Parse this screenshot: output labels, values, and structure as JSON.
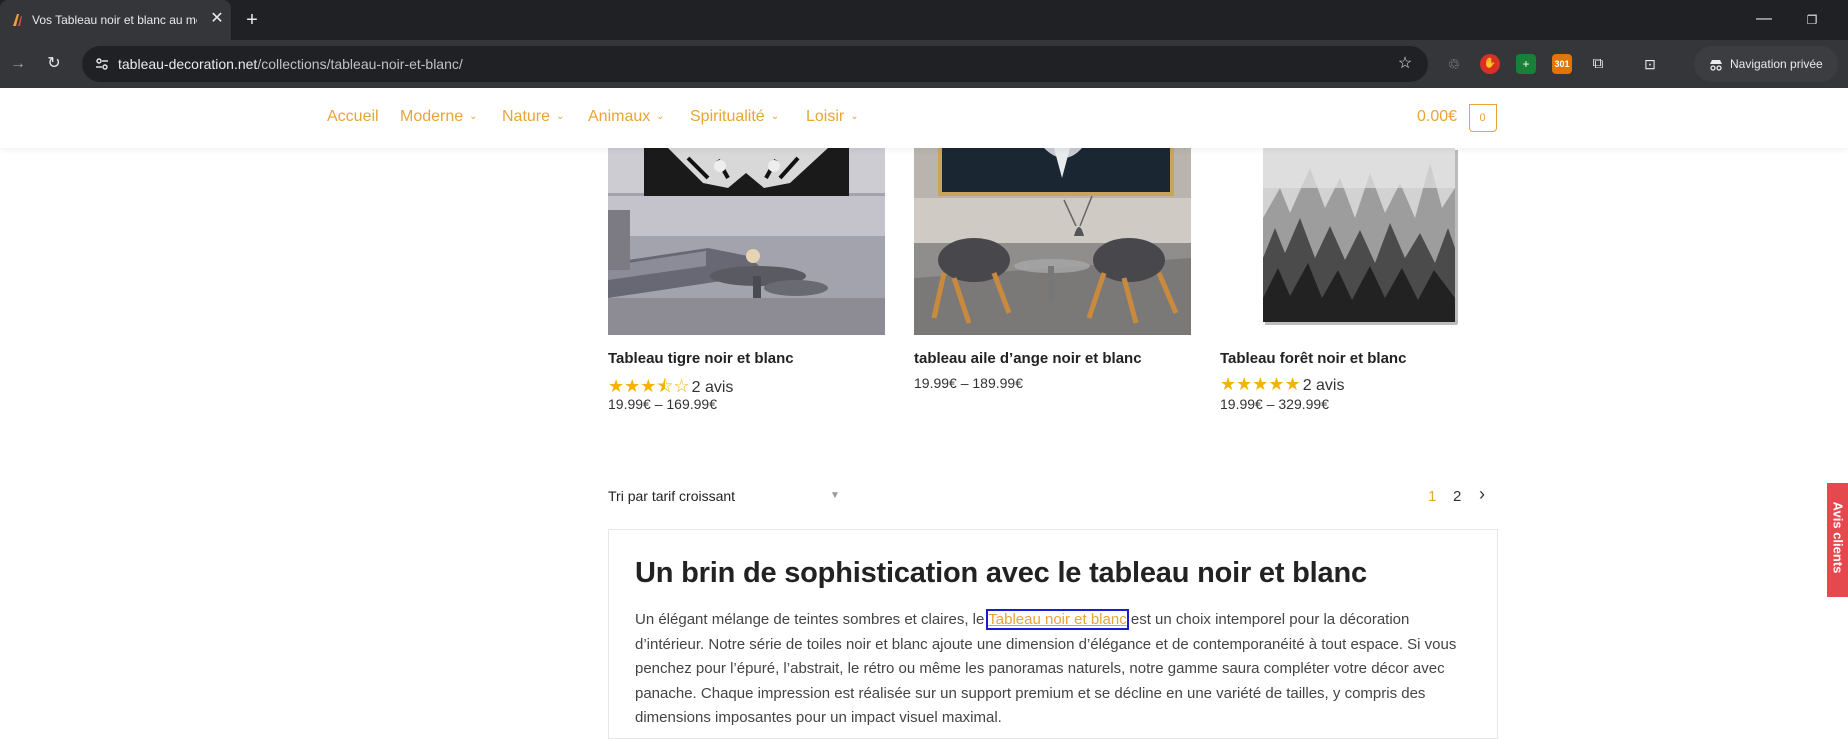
{
  "browser": {
    "tab_title": "Vos Tableau noir et blanc au meilleur prix",
    "url_host": "tableau-decoration.net",
    "url_path": "/collections/tableau-noir-et-blanc/",
    "private_label": "Navigation privée",
    "extension_badge": "301"
  },
  "nav": {
    "items": [
      {
        "label": "Accueil"
      },
      {
        "label": "Moderne"
      },
      {
        "label": "Nature"
      },
      {
        "label": "Animaux"
      },
      {
        "label": "Spiritualité"
      },
      {
        "label": "Loisir"
      }
    ],
    "cart_total": "0.00€",
    "cart_count": "0"
  },
  "products": [
    {
      "title": "Tableau tigre noir et blanc",
      "stars": "★★★⯪☆",
      "rating": 3.5,
      "reviews": "2 avis",
      "price": "19.99€ – 169.99€"
    },
    {
      "title": "tableau aile d’ange noir et blanc",
      "price": "19.99€ – 189.99€"
    },
    {
      "title": "Tableau forêt noir et blanc",
      "stars": "★★★★★",
      "rating": 5,
      "reviews": "2 avis",
      "price": "19.99€ – 329.99€"
    }
  ],
  "sort": {
    "label": "Tri par tarif croissant"
  },
  "pagination": {
    "current": "1",
    "next_page": "2",
    "next_icon": "›"
  },
  "description": {
    "title": "Un brin de sophistication avec le tableau noir et blanc",
    "text_before": "Un élégant mélange de teintes sombres et claires, le ",
    "link": "Tableau noir et blanc",
    "text_after": " est un choix intemporel pour la décoration d’intérieur. Notre série de toiles noir et blanc ajoute une dimension d’élégance et de contemporanéité à tout espace. Si vous penchez pour l’épuré, l’abstrait, le rétro ou même les panoramas naturels, notre gamme saura compléter votre décor avec panache. Chaque impression est réalisée sur un support premium et se décline en une variété de tailles, y compris des dimensions imposantes pour un impact visuel maximal."
  },
  "side_tab": {
    "label": "Avis clients"
  },
  "colors": {
    "accent": "#e8a437",
    "star": "#f5b301",
    "side_tab": "#e5484d"
  }
}
